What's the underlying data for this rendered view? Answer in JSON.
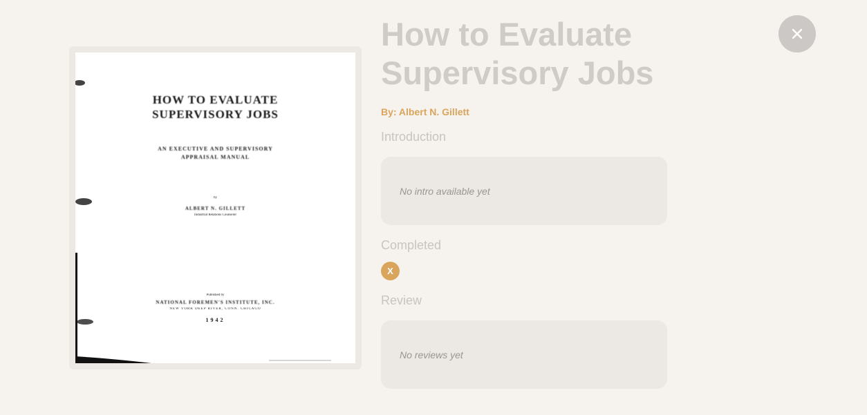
{
  "book": {
    "title": "How to Evaluate Supervisory Jobs",
    "author_line": "By: Albert N. Gillett"
  },
  "cover": {
    "title_line1": "HOW TO EVALUATE",
    "title_line2": "SUPERVISORY JOBS",
    "subtitle_line1": "AN EXECUTIVE AND SUPERVISORY",
    "subtitle_line2": "APPRAISAL MANUAL",
    "by": "by",
    "author": "ALBERT N. GILLETT",
    "author_role": "Industrial Relations Counselor",
    "publisher_line1": "Published by",
    "publisher_line2": "NATIONAL FOREMEN'S INSTITUTE, INC.",
    "publisher_line3": "NEW YORK    DEEP RIVER, CONN.    CHICAGO",
    "year": "1942"
  },
  "sections": {
    "intro_label": "Introduction",
    "intro_text": "No intro available yet",
    "completed_label": "Completed",
    "completed_value": "X",
    "review_label": "Review",
    "review_text": "No reviews yet"
  },
  "colors": {
    "accent": "#d9a55c",
    "background": "#f6f2ed",
    "panel": "#ece8e4",
    "close_button": "#cbc8c5"
  },
  "icons": {
    "close": "close-icon"
  }
}
